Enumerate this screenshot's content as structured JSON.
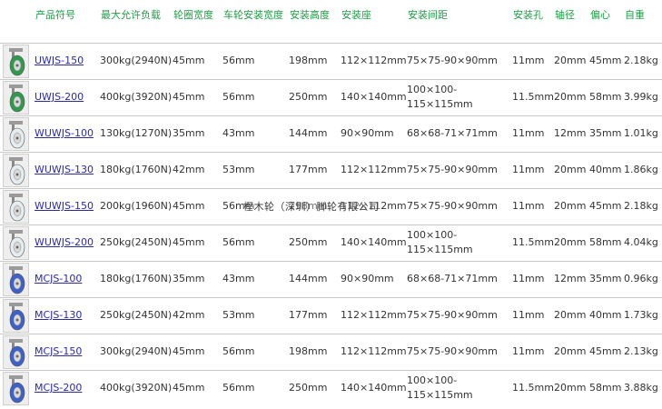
{
  "headers": [
    "",
    "产品符号",
    "最大允许负载",
    "轮圈宽度",
    "车轮安装宽度",
    "安装高度",
    "安装座",
    "安装间距",
    "安装孔",
    "轴径",
    "偏心",
    "自重"
  ],
  "watermark": "樫木轮（深圳）脚轮有限公司",
  "thumb_colors": {
    "green": "#2f9a4e",
    "white": "#e6ecf0",
    "blue": "#3c62c8"
  },
  "rows": [
    {
      "model": "UWJS-150",
      "load": "300kg(2940N)",
      "rim_width": "45mm",
      "wheel_width": "56mm",
      "height": "198mm",
      "plate": "112×112mm",
      "spacing": "75×75-90×90mm",
      "hole": "11mm",
      "axle": "20mm",
      "offset": "45mm",
      "weight": "2.18kg",
      "wheel_type": "green-wheel-icon"
    },
    {
      "model": "UWJS-200",
      "load": "400kg(3920N)",
      "rim_width": "45mm",
      "wheel_width": "56mm",
      "height": "250mm",
      "plate": "140×140mm",
      "spacing": "100×100-115×115mm",
      "hole": "11.5mm",
      "axle": "20mm",
      "offset": "58mm",
      "weight": "3.99kg",
      "wheel_type": "green-wheel-icon"
    },
    {
      "model": "WUWJS-100",
      "load": "130kg(1270N)",
      "rim_width": "35mm",
      "wheel_width": "43mm",
      "height": "144mm",
      "plate": "90×90mm",
      "spacing": "68×68-71×71mm",
      "hole": "11mm",
      "axle": "12mm",
      "offset": "35mm",
      "weight": "1.01kg",
      "wheel_type": "white-wheel-icon"
    },
    {
      "model": "WUWJS-130",
      "load": "180kg(1760N)",
      "rim_width": "42mm",
      "wheel_width": "53mm",
      "height": "177mm",
      "plate": "112×112mm",
      "spacing": "75×75-90×90mm",
      "hole": "11mm",
      "axle": "20mm",
      "offset": "40mm",
      "weight": "1.86kg",
      "wheel_type": "white-wheel-icon"
    },
    {
      "model": "WUWJS-150",
      "load": "200kg(1960N)",
      "rim_width": "45mm",
      "wheel_width": "56mm",
      "height": "198mm",
      "plate": "112×112mm",
      "spacing": "75×75-90×90mm",
      "hole": "11mm",
      "axle": "20mm",
      "offset": "45mm",
      "weight": "2.18kg",
      "wheel_type": "white-wheel-icon"
    },
    {
      "model": "WUWJS-200",
      "load": "250kg(2450N)",
      "rim_width": "45mm",
      "wheel_width": "56mm",
      "height": "250mm",
      "plate": "140×140mm",
      "spacing": "100×100-115×115mm",
      "hole": "11.5mm",
      "axle": "20mm",
      "offset": "58mm",
      "weight": "4.04kg",
      "wheel_type": "white-wheel-icon"
    },
    {
      "model": "MCJS-100",
      "load": "180kg(1760N)",
      "rim_width": "35mm",
      "wheel_width": "43mm",
      "height": "144mm",
      "plate": "90×90mm",
      "spacing": "68×68-71×71mm",
      "hole": "11mm",
      "axle": "12mm",
      "offset": "35mm",
      "weight": "0.96kg",
      "wheel_type": "blue-wheel-icon"
    },
    {
      "model": "MCJS-130",
      "load": "250kg(2450N)",
      "rim_width": "42mm",
      "wheel_width": "53mm",
      "height": "177mm",
      "plate": "112×112mm",
      "spacing": "75×75-90×90mm",
      "hole": "11mm",
      "axle": "20mm",
      "offset": "40mm",
      "weight": "1.73kg",
      "wheel_type": "blue-wheel-icon"
    },
    {
      "model": "MCJS-150",
      "load": "300kg(2940N)",
      "rim_width": "45mm",
      "wheel_width": "56mm",
      "height": "198mm",
      "plate": "112×112mm",
      "spacing": "75×75-90×90mm",
      "hole": "11mm",
      "axle": "20mm",
      "offset": "45mm",
      "weight": "2.13kg",
      "wheel_type": "blue-wheel-icon"
    },
    {
      "model": "MCJS-200",
      "load": "400kg(3920N)",
      "rim_width": "45mm",
      "wheel_width": "56mm",
      "height": "250mm",
      "plate": "140×140mm",
      "spacing": "100×100-115×115mm",
      "hole": "11.5mm",
      "axle": "20mm",
      "offset": "58mm",
      "weight": "3.88kg",
      "wheel_type": "blue-wheel-icon"
    }
  ]
}
